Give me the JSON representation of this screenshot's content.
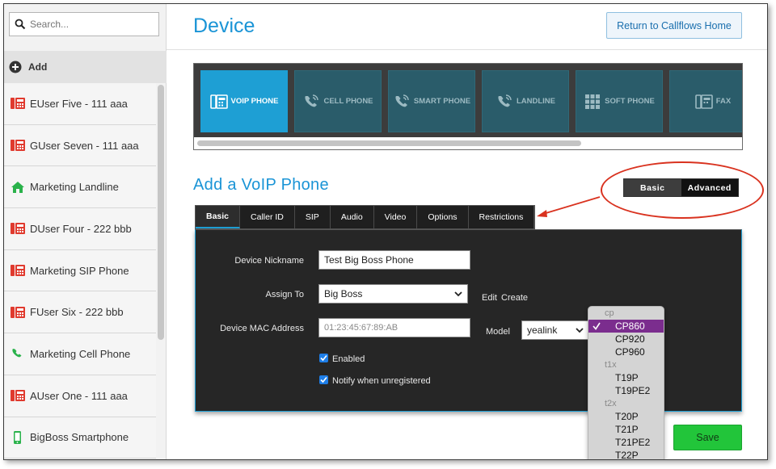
{
  "sidebar": {
    "search": {
      "placeholder": "Search..."
    },
    "add_label": "Add",
    "items": [
      {
        "label": "EUser Five - 111 aaa",
        "icon": "voip-phone-icon",
        "color": "#e03a2e"
      },
      {
        "label": "GUser Seven - 111 aaa",
        "icon": "voip-phone-icon",
        "color": "#e03a2e"
      },
      {
        "label": "Marketing Landline",
        "icon": "home-icon",
        "color": "#2ab24b"
      },
      {
        "label": "DUser Four - 222 bbb",
        "icon": "voip-phone-icon",
        "color": "#e03a2e"
      },
      {
        "label": "Marketing SIP Phone",
        "icon": "voip-phone-icon",
        "color": "#e03a2e"
      },
      {
        "label": "FUser Six - 222 bbb",
        "icon": "voip-phone-icon",
        "color": "#e03a2e"
      },
      {
        "label": "Marketing Cell Phone",
        "icon": "phone-handset-icon",
        "color": "#2ab24b"
      },
      {
        "label": "AUser One - 111 aaa",
        "icon": "voip-phone-icon",
        "color": "#e03a2e"
      },
      {
        "label": "BigBoss Smartphone",
        "icon": "smartphone-icon",
        "color": "#2ab24b"
      }
    ]
  },
  "header": {
    "title": "Device",
    "return_button": "Return to Callflows Home"
  },
  "device_types": [
    {
      "label": "VOIP PHONE",
      "icon": "voip-phone-icon",
      "active": true
    },
    {
      "label": "CELL PHONE",
      "icon": "cell-phone-icon",
      "active": false
    },
    {
      "label": "SMART PHONE",
      "icon": "smart-phone-icon",
      "active": false
    },
    {
      "label": "LANDLINE",
      "icon": "landline-icon",
      "active": false
    },
    {
      "label": "SOFT PHONE",
      "icon": "soft-phone-icon",
      "active": false
    },
    {
      "label": "FAX",
      "icon": "fax-icon",
      "active": false
    }
  ],
  "section": {
    "title": "Add a VoIP Phone",
    "mode_basic": "Basic",
    "mode_advanced": "Advanced"
  },
  "tabs": [
    "Basic",
    "Caller ID",
    "SIP",
    "Audio",
    "Video",
    "Options",
    "Restrictions"
  ],
  "form": {
    "nickname_label": "Device Nickname",
    "nickname_value": "Test Big Boss Phone",
    "assign_label": "Assign To",
    "assign_value": "Big Boss",
    "edit_link": "Edit",
    "create_link": "Create",
    "mac_label": "Device MAC Address",
    "mac_placeholder": "01:23:45:67:89:AB",
    "model_label": "Model",
    "model_value": "yealink",
    "enabled_label": "Enabled",
    "notify_label": "Notify when unregistered"
  },
  "model_dropdown": {
    "groups": [
      {
        "name": "cp",
        "options": [
          "CP860",
          "CP920",
          "CP960"
        ]
      },
      {
        "name": "t1x",
        "options": [
          "T19P",
          "T19PE2"
        ]
      },
      {
        "name": "t2x",
        "options": [
          "T20P",
          "T21P",
          "T21PE2",
          "T22P"
        ]
      }
    ],
    "selected": "CP860"
  },
  "save_button": "Save",
  "colors": {
    "accent": "#1a94d6",
    "annotation": "#d9321f",
    "save": "#22c53a",
    "selected_option": "#7b2d8e"
  }
}
